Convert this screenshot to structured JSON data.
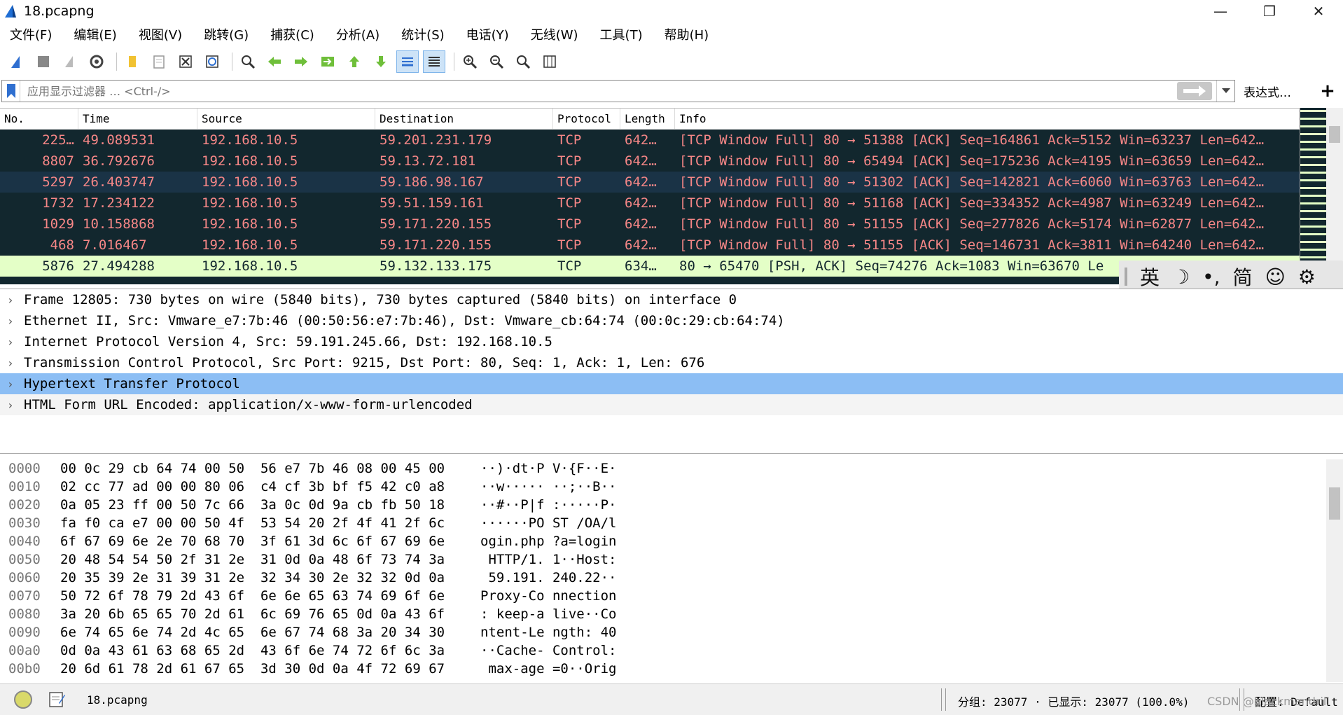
{
  "window": {
    "title": "18.pcapng",
    "minimize": "—",
    "restore": "❐",
    "close": "✕"
  },
  "menu": [
    "文件(F)",
    "编辑(E)",
    "视图(V)",
    "跳转(G)",
    "捕获(C)",
    "分析(A)",
    "统计(S)",
    "电话(Y)",
    "无线(W)",
    "工具(T)",
    "帮助(H)"
  ],
  "toolbar_icons": [
    "shark-fin-icon",
    "stop-icon",
    "restart-icon",
    "options-gear-icon",
    "open-folder-icon",
    "file-set-icon",
    "close-file-icon",
    "reload-icon",
    "find-icon",
    "go-back-icon",
    "go-forward-icon",
    "go-to-packet-icon",
    "first-packet-icon",
    "last-packet-icon",
    "autoscroll-icon",
    "colorize-icon",
    "zoom-in-icon",
    "zoom-out-icon",
    "normal-size-icon",
    "resize-columns-icon"
  ],
  "filter": {
    "placeholder": "应用显示过滤器 … <Ctrl-/>",
    "expression_label": "表达式…",
    "add_label": "+"
  },
  "packet_list": {
    "columns": [
      "No.",
      "Time",
      "Source",
      "Destination",
      "Protocol",
      "Length",
      "Info"
    ],
    "rows": [
      {
        "no": "225…",
        "time": "49.089531",
        "src": "192.168.10.5",
        "dst": "59.201.231.179",
        "proto": "TCP",
        "len": "642…",
        "info": "[TCP Window Full] 80 → 51388 [ACK] Seq=164861 Ack=5152 Win=63237 Len=642…",
        "style": "warn"
      },
      {
        "no": "8807",
        "time": "36.792676",
        "src": "192.168.10.5",
        "dst": "59.13.72.181",
        "proto": "TCP",
        "len": "642…",
        "info": "[TCP Window Full] 80 → 65494 [ACK] Seq=175236 Ack=4195 Win=63659 Len=642…",
        "style": "warn"
      },
      {
        "no": "5297",
        "time": "26.403747",
        "src": "192.168.10.5",
        "dst": "59.186.98.167",
        "proto": "TCP",
        "len": "642…",
        "info": "[TCP Window Full] 80 → 51302 [ACK] Seq=142821 Ack=6060 Win=63763 Len=642…",
        "style": "warn sel"
      },
      {
        "no": "1732",
        "time": "17.234122",
        "src": "192.168.10.5",
        "dst": "59.51.159.161",
        "proto": "TCP",
        "len": "642…",
        "info": "[TCP Window Full] 80 → 51168 [ACK] Seq=334352 Ack=4987 Win=63249 Len=642…",
        "style": "warn"
      },
      {
        "no": "1029",
        "time": "10.158868",
        "src": "192.168.10.5",
        "dst": "59.171.220.155",
        "proto": "TCP",
        "len": "642…",
        "info": "[TCP Window Full] 80 → 51155 [ACK] Seq=277826 Ack=5174 Win=62877 Len=642…",
        "style": "warn"
      },
      {
        "no": "468",
        "time": "7.016467",
        "src": "192.168.10.5",
        "dst": "59.171.220.155",
        "proto": "TCP",
        "len": "642…",
        "info": "[TCP Window Full] 80 → 51155 [ACK] Seq=146731 Ack=3811 Win=64240 Len=642…",
        "style": "warn"
      },
      {
        "no": "5876",
        "time": "27.494288",
        "src": "192.168.10.5",
        "dst": "59.132.133.175",
        "proto": "TCP",
        "len": "634…",
        "info": "80 → 65470 [PSH, ACK] Seq=74276 Ack=1083 Win=63670 Le",
        "style": "ok"
      }
    ]
  },
  "ime": {
    "lang": "英",
    "moon": "☽",
    "punct": "•,",
    "simp": "简",
    "emoji": "☺",
    "gear": "⚙"
  },
  "details": [
    {
      "text": "Frame 12805: 730 bytes on wire (5840 bits), 730 bytes captured (5840 bits) on interface 0",
      "selected": false
    },
    {
      "text": "Ethernet II, Src: Vmware_e7:7b:46 (00:50:56:e7:7b:46), Dst: Vmware_cb:64:74 (00:0c:29:cb:64:74)",
      "selected": false
    },
    {
      "text": "Internet Protocol Version 4, Src: 59.191.245.66, Dst: 192.168.10.5",
      "selected": false
    },
    {
      "text": "Transmission Control Protocol, Src Port: 9215, Dst Port: 80, Seq: 1, Ack: 1, Len: 676",
      "selected": false
    },
    {
      "text": "Hypertext Transfer Protocol",
      "selected": true
    },
    {
      "text": "HTML Form URL Encoded: application/x-www-form-urlencoded",
      "selected": false
    }
  ],
  "hex": [
    {
      "off": "0000",
      "bytes": "00 0c 29 cb 64 74 00 50  56 e7 7b 46 08 00 45 00",
      "ascii": "··)·dt·P V·{F··E·"
    },
    {
      "off": "0010",
      "bytes": "02 cc 77 ad 00 00 80 06  c4 cf 3b bf f5 42 c0 a8",
      "ascii": "··w····· ··;··B··"
    },
    {
      "off": "0020",
      "bytes": "0a 05 23 ff 00 50 7c 66  3a 0c 0d 9a cb fb 50 18",
      "ascii": "··#··P|f :·····P·"
    },
    {
      "off": "0030",
      "bytes": "fa f0 ca e7 00 00 50 4f  53 54 20 2f 4f 41 2f 6c",
      "ascii": "······PO ST /OA/l"
    },
    {
      "off": "0040",
      "bytes": "6f 67 69 6e 2e 70 68 70  3f 61 3d 6c 6f 67 69 6e",
      "ascii": "ogin.php ?a=login"
    },
    {
      "off": "0050",
      "bytes": "20 48 54 54 50 2f 31 2e  31 0d 0a 48 6f 73 74 3a",
      "ascii": " HTTP/1. 1··Host:"
    },
    {
      "off": "0060",
      "bytes": "20 35 39 2e 31 39 31 2e  32 34 30 2e 32 32 0d 0a",
      "ascii": " 59.191. 240.22··"
    },
    {
      "off": "0070",
      "bytes": "50 72 6f 78 79 2d 43 6f  6e 6e 65 63 74 69 6f 6e",
      "ascii": "Proxy-Co nnection"
    },
    {
      "off": "0080",
      "bytes": "3a 20 6b 65 65 70 2d 61  6c 69 76 65 0d 0a 43 6f",
      "ascii": ": keep-a live··Co"
    },
    {
      "off": "0090",
      "bytes": "6e 74 65 6e 74 2d 4c 65  6e 67 74 68 3a 20 34 30",
      "ascii": "ntent-Le ngth: 40"
    },
    {
      "off": "00a0",
      "bytes": "0d 0a 43 61 63 68 65 2d  43 6f 6e 74 72 6f 6c 3a",
      "ascii": "··Cache- Control:"
    },
    {
      "off": "00b0",
      "bytes": "20 6d 61 78 2d 61 67 65  3d 30 0d 0a 4f 72 69 67",
      "ascii": " max-age =0··Orig"
    }
  ],
  "status": {
    "file": "18.pcapng",
    "stats": "分组: 23077 · 已显示: 23077 (100.0%)",
    "profile": "配置: Default"
  },
  "watermark": "CSDN @blackmandrill",
  "colors": {
    "warn_bg": "#12272e",
    "warn_fg": "#f78787",
    "ok_bg": "#e4ffc7",
    "selected_detail": "#8cbef4"
  }
}
